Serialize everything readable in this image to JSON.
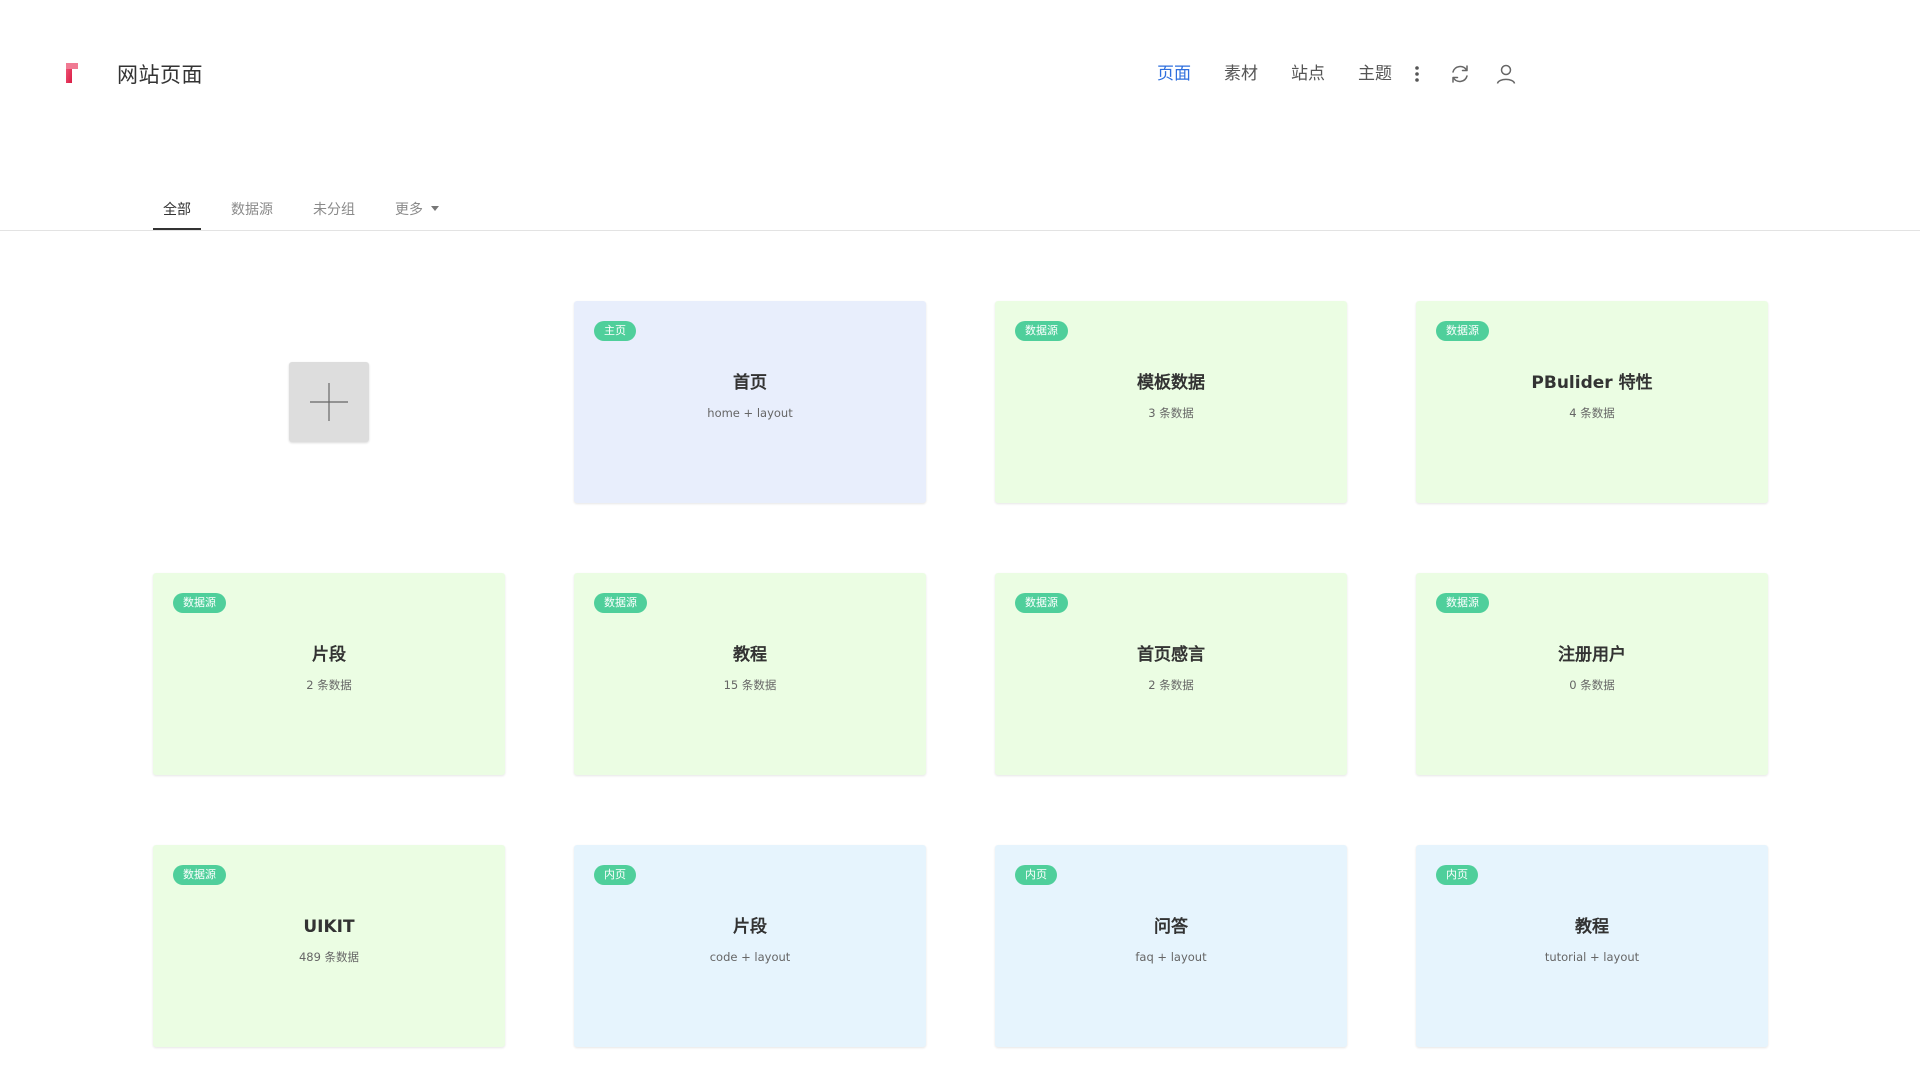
{
  "header": {
    "logo_color": "#e8385a",
    "title": "网站页面",
    "nav": [
      {
        "label": "页面",
        "active": true
      },
      {
        "label": "素材",
        "active": false
      },
      {
        "label": "站点",
        "active": false
      },
      {
        "label": "主题",
        "active": false
      }
    ],
    "icons": [
      "more-vertical-icon",
      "sync-icon",
      "user-icon"
    ],
    "active_color": "#2f6fde"
  },
  "tabs": [
    {
      "label": "全部",
      "active": true
    },
    {
      "label": "数据源",
      "active": false
    },
    {
      "label": "未分组",
      "active": false
    },
    {
      "label": "更多",
      "active": false,
      "dropdown": true
    }
  ],
  "add_button": {
    "icon": "plus-icon"
  },
  "cards": [
    {
      "badge": "主页",
      "title": "首页",
      "subtitle": "home + layout",
      "color": "#e8eefc"
    },
    {
      "badge": "数据源",
      "title": "模板数据",
      "subtitle": "3 条数据",
      "color": "#ebfde3"
    },
    {
      "badge": "数据源",
      "title": "PBulider 特性",
      "subtitle": "4 条数据",
      "color": "#ebfde3"
    },
    {
      "badge": "数据源",
      "title": "片段",
      "subtitle": "2 条数据",
      "color": "#ebfde3"
    },
    {
      "badge": "数据源",
      "title": "教程",
      "subtitle": "15 条数据",
      "color": "#ebfde3"
    },
    {
      "badge": "数据源",
      "title": "首页感言",
      "subtitle": "2 条数据",
      "color": "#ebfde3"
    },
    {
      "badge": "数据源",
      "title": "注册用户",
      "subtitle": "0 条数据",
      "color": "#ebfde3"
    },
    {
      "badge": "数据源",
      "title": "UIKIT",
      "subtitle": "489 条数据",
      "color": "#ebfde3"
    },
    {
      "badge": "内页",
      "title": "片段",
      "subtitle": "code + layout",
      "color": "#e6f4fd"
    },
    {
      "badge": "内页",
      "title": "问答",
      "subtitle": "faq + layout",
      "color": "#e6f4fd"
    },
    {
      "badge": "内页",
      "title": "教程",
      "subtitle": "tutorial + layout",
      "color": "#e6f4fd"
    }
  ],
  "badge_color": "#4fcf9b"
}
